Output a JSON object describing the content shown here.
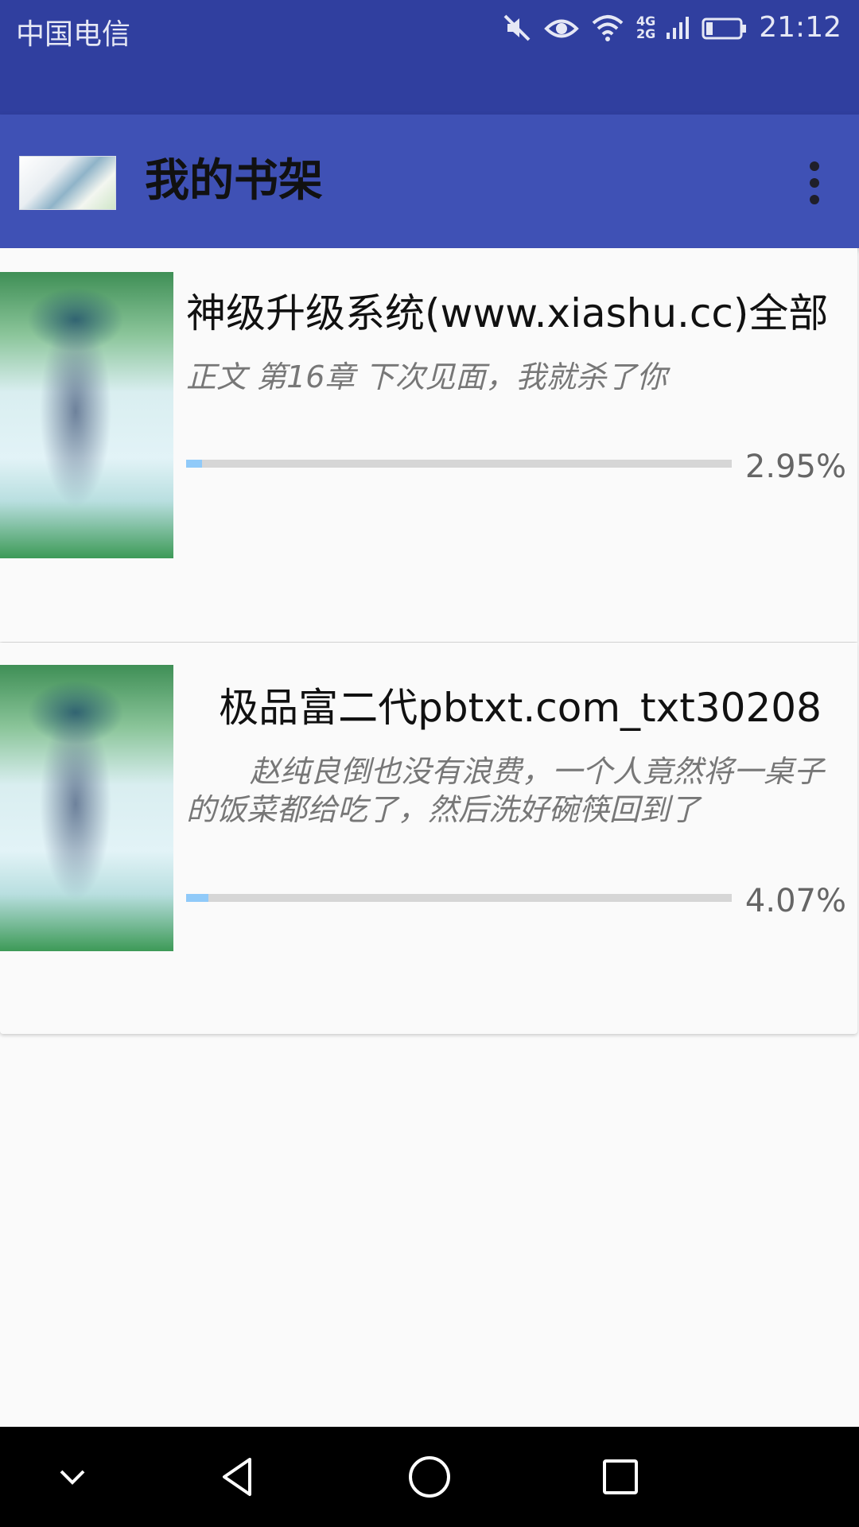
{
  "status_bar": {
    "carrier": "中国电信",
    "network_top": "4G",
    "network_bottom": "2G",
    "time": "21:12",
    "battery_level": 0.2,
    "icons": [
      "mute-icon",
      "eye-comfort-icon",
      "wifi-icon",
      "signal-icon",
      "battery-icon"
    ]
  },
  "app_bar": {
    "title": "我的书架",
    "logo_icon": "app-logo",
    "menu_icon": "more-vertical-icon"
  },
  "books": [
    {
      "title": "神级升级系统(www.xiashu.cc)全部",
      "snippet": "正文 第16章 下次见面，我就杀了你",
      "progress_text": "2.95%",
      "progress": 0.0295
    },
    {
      "title": "极品富二代pbtxt.com_txt30208",
      "snippet": "赵纯良倒也没有浪费，一个人竟然将一桌子的饭菜都给吃了，然后洗好碗筷回到了",
      "progress_text": "4.07%",
      "progress": 0.0407
    }
  ],
  "nav_bar": {
    "icons": [
      "chevron-down-icon",
      "back-icon",
      "home-icon",
      "recents-icon"
    ]
  },
  "colors": {
    "status_bar": "#303f9f",
    "app_bar": "#3f51b5",
    "progress_fill": "#90caf9",
    "progress_track": "#d6d6d6"
  }
}
